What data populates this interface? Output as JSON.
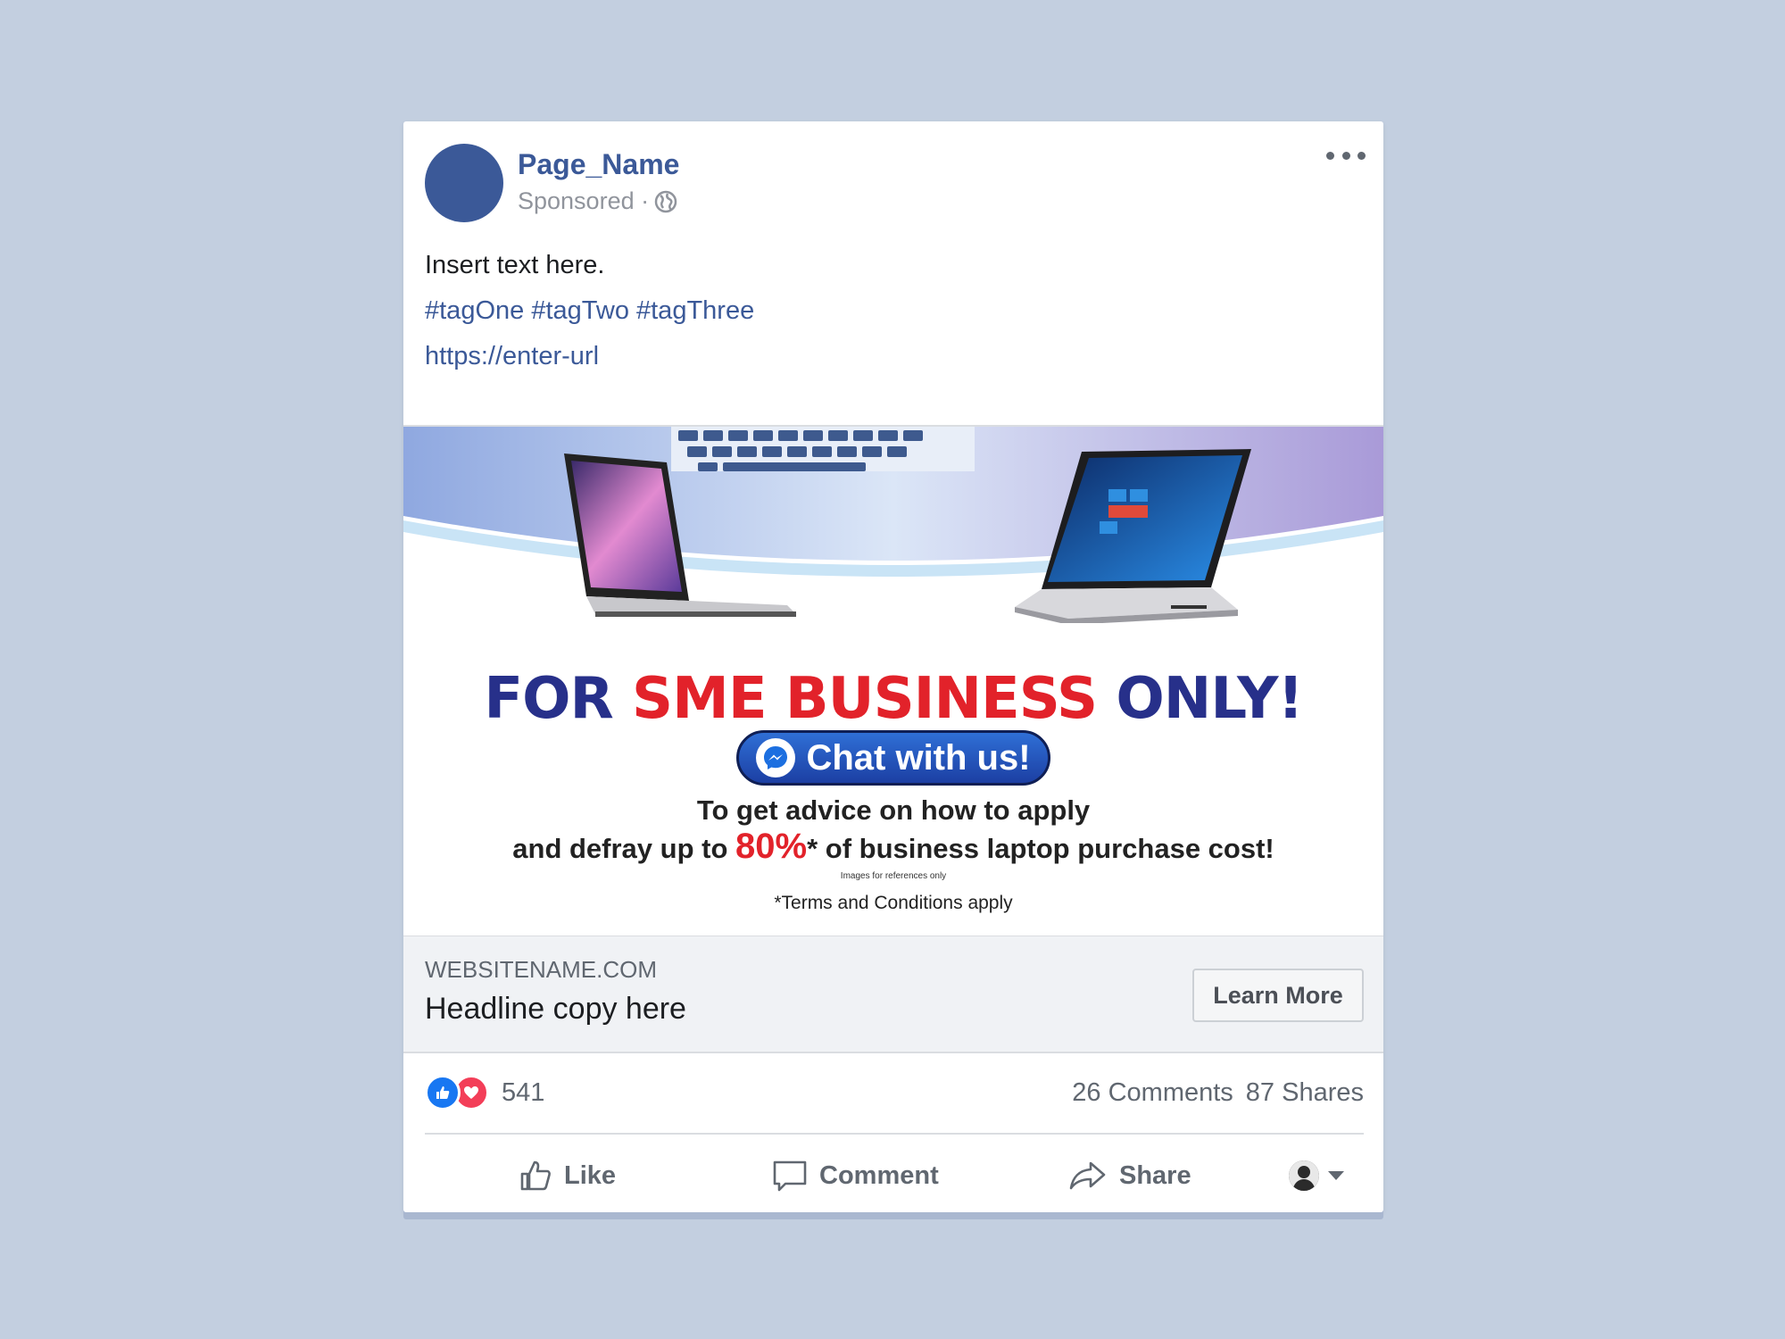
{
  "post": {
    "page_name": "Page_Name",
    "sponsored": "Sponsored ·",
    "text": "Insert text here.",
    "hashtags": "#tagOne #tagTwo #tagThree",
    "url": "https://enter-url"
  },
  "creative": {
    "headline_part1": "FOR ",
    "headline_part2": "SME BUSINESS",
    "headline_part3": " ONLY!",
    "chat_button": "Chat with us!",
    "copy_line1": "To get advice on how to apply",
    "copy_line2a": "and defray up to ",
    "copy_pct": "80%",
    "copy_line2b": "* of business laptop purchase cost!",
    "fine_print": "Images for references only",
    "terms": "*Terms and Conditions apply",
    "colors": {
      "navy": "#27308a",
      "red": "#e2222a",
      "button_blue": "#2f6fd6"
    }
  },
  "link_preview": {
    "site": "WEBSITENAME.COM",
    "headline": "Headline copy here",
    "cta": "Learn More"
  },
  "engagement": {
    "reaction_count": "541",
    "comments": "26 Comments",
    "shares": "87 Shares"
  },
  "actions": {
    "like": "Like",
    "comment": "Comment",
    "share": "Share"
  },
  "icons": [
    "globe-icon",
    "more-icon",
    "messenger-icon",
    "like-reaction-icon",
    "love-reaction-icon",
    "thumbs-up-icon",
    "comment-icon",
    "share-icon",
    "profile-avatar",
    "caret-down-icon"
  ],
  "brand_color": "#3b5998"
}
